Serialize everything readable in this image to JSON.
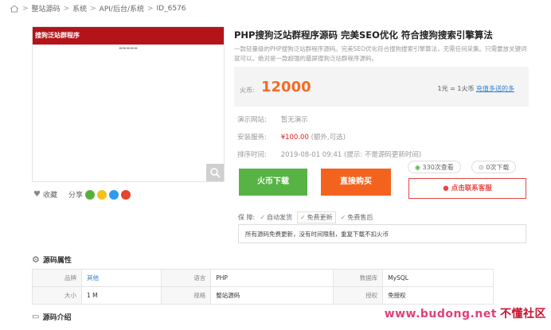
{
  "breadcrumb": [
    "整站源码",
    "系统",
    "API/后台/系统",
    "ID_6576"
  ],
  "preview": {
    "banner_text": "搜狗泛站群程序",
    "sub_text": "▬▬▬▬▬"
  },
  "actions": {
    "favorite": "收藏",
    "share": "分享"
  },
  "product": {
    "title": "PHP搜狗泛站群程序源码 完美SEO优化 符合搜狗搜索引擎算法",
    "desc": "一款轻量级的PHP搜狗泛站群程序源码。完美SEO优化符合搜狗搜索引擎算法，无需任何采集。只需要放关键词就可以。绝对是一款超强的最屏搜狗泛站群程序源码。"
  },
  "price": {
    "label": "火币:",
    "value": "12000",
    "rate_text": "1元 = 1火币",
    "rate_link": "充值多送的多"
  },
  "info": {
    "demo_label": "演示网站:",
    "demo_value": "暂无演示",
    "install_label": "安装服务:",
    "install_value": "¥100.00",
    "install_note": "(额外,可选)",
    "time_label": "排序时间:",
    "time_value": "2019-08-01 09:41",
    "time_note": "(提示: 不是源码更新时间)"
  },
  "stats": {
    "views": "330次查看",
    "downloads": "0次下载"
  },
  "buttons": {
    "buy_coin": "火币下载",
    "buy_direct": "直接购买",
    "contact": "点击联系客服"
  },
  "guarantee": {
    "label": "保  障:",
    "items": [
      "自动发货",
      "免费更新",
      "免费售后"
    ]
  },
  "notice": "所有源码免费更新，没有时间限制，重复下载不扣火币",
  "attributes": {
    "title": "源码属性",
    "rows": [
      [
        {
          "k": "品牌",
          "v": "其他",
          "blue": true
        },
        {
          "k": "语言",
          "v": "PHP"
        },
        {
          "k": "数据库",
          "v": "MySQL"
        }
      ],
      [
        {
          "k": "大小",
          "v": "1 M"
        },
        {
          "k": "规格",
          "v": "整站源码"
        },
        {
          "k": "授权",
          "v": "免授权"
        }
      ]
    ]
  },
  "intro": {
    "title": "源码介绍"
  },
  "watermark": {
    "url": "www.budong.net",
    "cn": "不懂社区"
  },
  "colors": {
    "accent": "#f26c28",
    "green": "#57b444",
    "orange": "#f4631e",
    "red": "#e94545",
    "link": "#2a7fd4"
  }
}
